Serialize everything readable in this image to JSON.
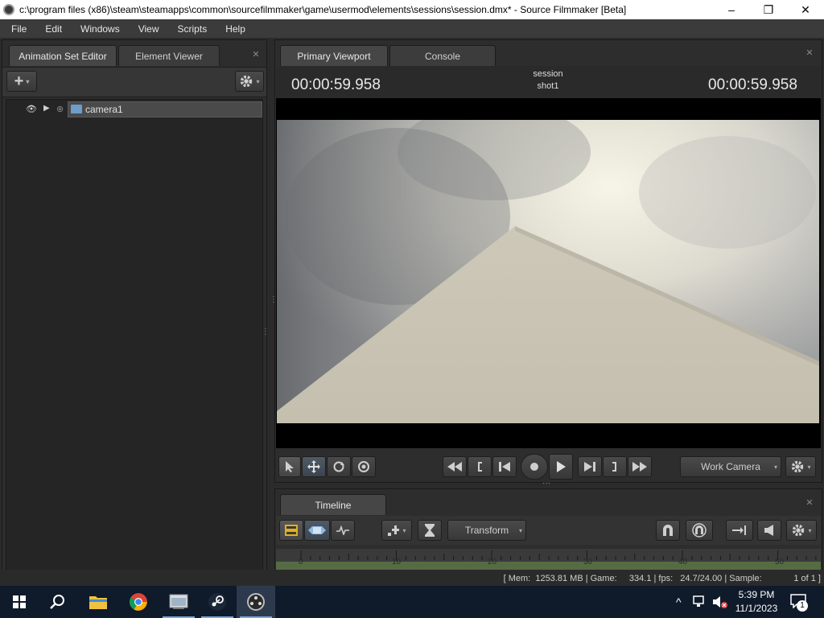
{
  "window": {
    "title": "c:\\program files (x86)\\steam\\steamapps\\common\\sourcefilmmaker\\game\\usermod\\elements\\sessions\\session.dmx* - Source Filmmaker [Beta]",
    "minimize": "–",
    "maximize": "❐",
    "close": "✕"
  },
  "menu": [
    "File",
    "Edit",
    "Windows",
    "View",
    "Scripts",
    "Help"
  ],
  "left_panel": {
    "tabs": [
      "Animation Set Editor",
      "Element Viewer"
    ],
    "add_label": "+",
    "tree": [
      {
        "label": "camera1"
      }
    ]
  },
  "viewport_panel": {
    "tabs": [
      "Primary Viewport",
      "Console"
    ],
    "time_left": "00:00:59.958",
    "time_right": "00:00:59.958",
    "session_label": "session",
    "shot_label": "shot1",
    "camera_dropdown": "Work Camera"
  },
  "timeline_panel": {
    "tab": "Timeline",
    "mode_dropdown": "Transform",
    "ruler_ticks": [
      "0",
      "10",
      "20",
      "30",
      "40",
      "50"
    ]
  },
  "status_bar": {
    "text": "[ Mem:  1253.81 MB | Game:     334.1 | fps:   24.7/24.00 | Sample:             1 of 1 ]"
  },
  "taskbar": {
    "time": "5:39 PM",
    "date": "11/1/2023",
    "notification_count": "1",
    "chevron": "^"
  },
  "colors": {
    "viewport_sky": "#c9c4b4",
    "viewport_floor": "#c7c1b2",
    "ruler_green": "#566b44",
    "taskbar": "#0f1a2a"
  }
}
